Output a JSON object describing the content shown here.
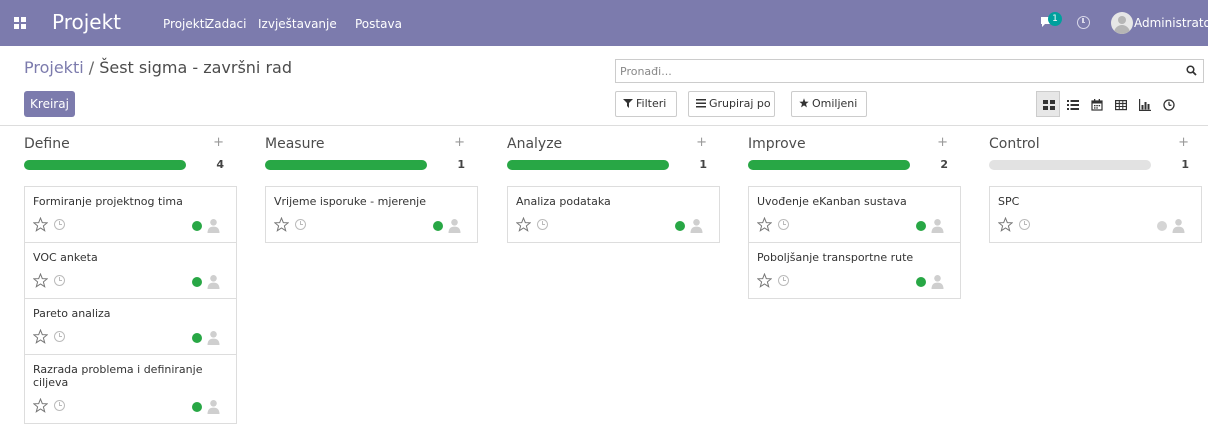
{
  "navbar": {
    "brand": "Projekt",
    "menu": [
      "Projekti",
      "Zadaci",
      "Izvještavanje",
      "Postava"
    ],
    "message_count": "1",
    "user_name": "Administrator",
    "color": "#7c7bad"
  },
  "breadcrumb": {
    "parent": "Projekti",
    "separator": " / ",
    "current": "Šest sigma - završni rad"
  },
  "create_button": "Kreiraj",
  "search": {
    "placeholder": "Pronađi..."
  },
  "filters": {
    "filter_label": "Filteri",
    "group_label": "Grupiraj po",
    "favorites_label": "Omiljeni"
  },
  "views": [
    "kanban",
    "list",
    "calendar",
    "pivot",
    "graph",
    "activity"
  ],
  "columns": [
    {
      "title": "Define",
      "count": "4",
      "progress": 1.0,
      "cards": [
        {
          "title": "Formiranje projektnog tima",
          "status": "green"
        },
        {
          "title": "VOC anketa",
          "status": "green"
        },
        {
          "title": "Pareto analiza",
          "status": "green"
        },
        {
          "title": "Razrada problema i definiranje ciljeva",
          "status": "green"
        }
      ]
    },
    {
      "title": "Measure",
      "count": "1",
      "progress": 1.0,
      "cards": [
        {
          "title": "Vrijeme isporuke - mjerenje",
          "status": "green"
        }
      ]
    },
    {
      "title": "Analyze",
      "count": "1",
      "progress": 1.0,
      "cards": [
        {
          "title": "Analiza podataka",
          "status": "green"
        }
      ]
    },
    {
      "title": "Improve",
      "count": "2",
      "progress": 1.0,
      "cards": [
        {
          "title": "Uvođenje eKanban sustava",
          "status": "green"
        },
        {
          "title": "Poboljšanje transportne rute",
          "status": "green"
        }
      ]
    },
    {
      "title": "Control",
      "count": "1",
      "progress": 0.0,
      "cards": [
        {
          "title": "SPC",
          "status": "grey"
        }
      ]
    }
  ],
  "colors": {
    "green": "#28a745",
    "grey": "#d5d5d5"
  }
}
